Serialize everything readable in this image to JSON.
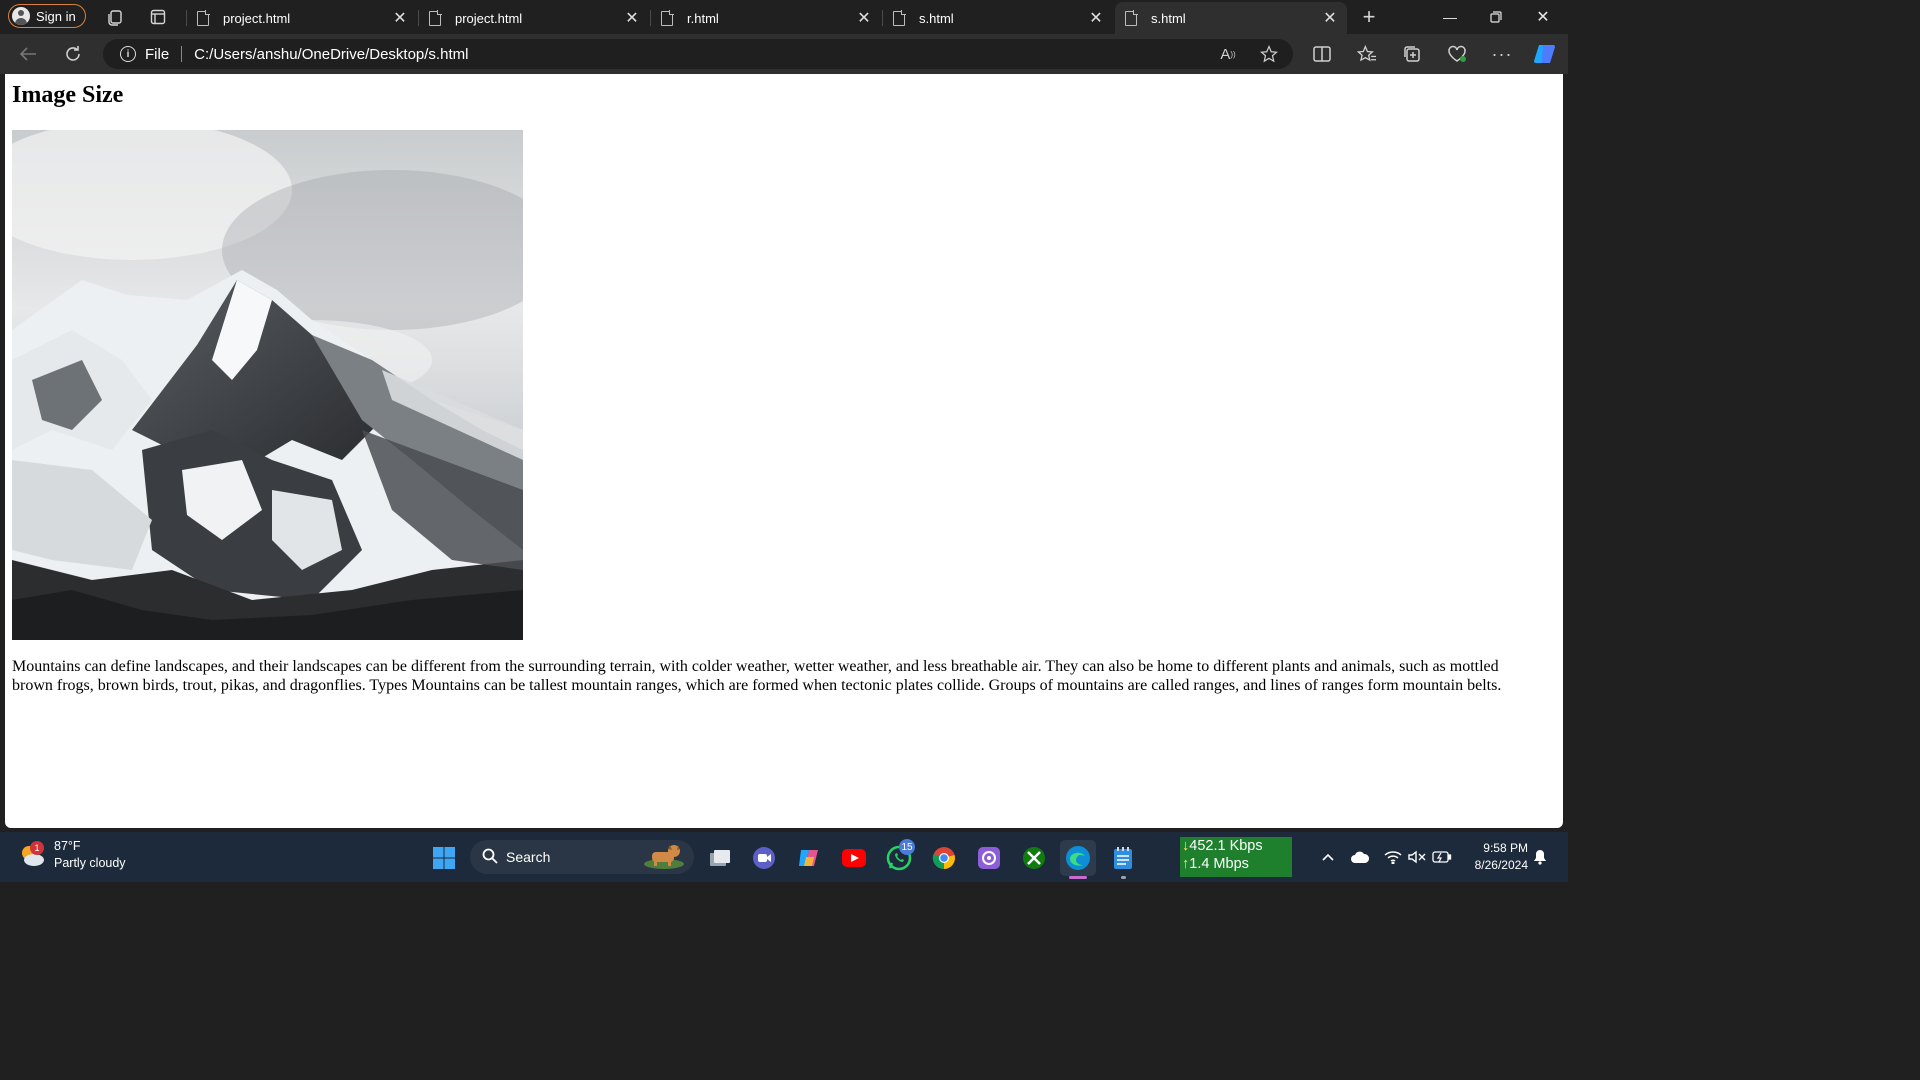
{
  "browser": {
    "signin_label": "Sign in",
    "tabs": [
      {
        "title": "project.html",
        "active": false
      },
      {
        "title": "project.html",
        "active": false
      },
      {
        "title": "r.html",
        "active": false
      },
      {
        "title": "s.html",
        "active": false
      },
      {
        "title": "s.html",
        "active": true
      }
    ],
    "address": {
      "scheme_label": "File",
      "url": "C:/Users/anshu/OneDrive/Desktop/s.html"
    }
  },
  "page": {
    "heading": "Image Size",
    "paragraph": "Mountains can define landscapes, and their landscapes can be different from the surrounding terrain, with colder weather, wetter weather, and less breathable air. They can also be home to different plants and animals, such as mottled brown frogs, brown birds, trout, pikas, and dragonflies. Types Mountains can be tallest mountain ranges, which are formed when tectonic plates collide. Groups of mountains are called ranges, and lines of ranges form mountain belts."
  },
  "taskbar": {
    "weather": {
      "temp": "87°F",
      "condition": "Partly cloudy",
      "badge": "1"
    },
    "search_label": "Search",
    "whatsapp_badge": "15",
    "network": {
      "down": "452.1 Kbps",
      "up": "1.4 Mbps"
    },
    "clock": {
      "time": "9:58 PM",
      "date": "8/26/2024"
    }
  },
  "colors": {
    "signin_border": "#d9823b",
    "taskbar_bg": "#1d2a3b",
    "network_bg": "#1e7f2d",
    "accent": "#0078d4"
  }
}
